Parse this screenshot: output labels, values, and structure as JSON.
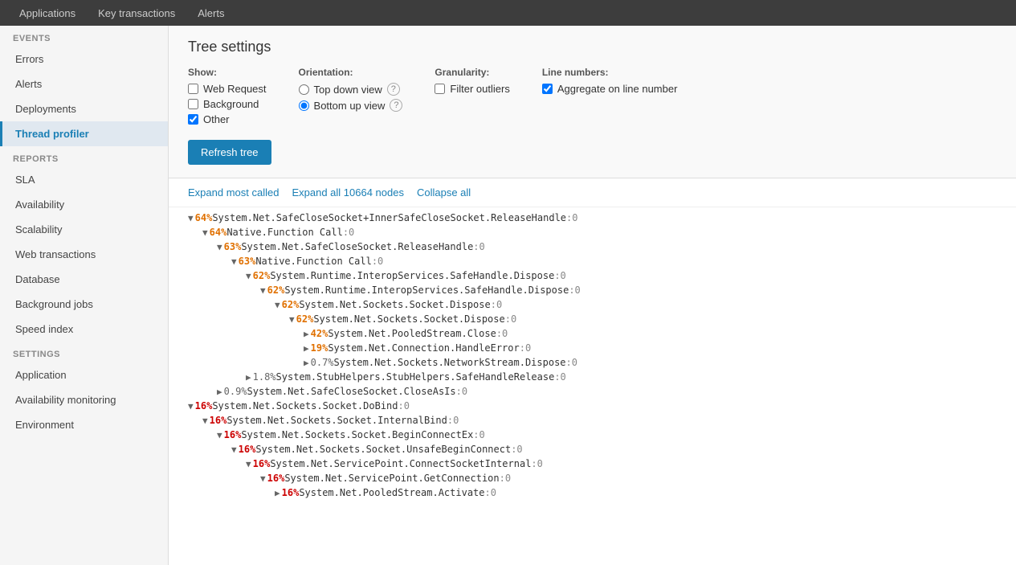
{
  "topNav": {
    "items": [
      {
        "label": "Applications",
        "active": false
      },
      {
        "label": "Key transactions",
        "active": false
      },
      {
        "label": "Alerts",
        "active": false
      }
    ]
  },
  "sidebar": {
    "events_label": "EVENTS",
    "reports_label": "REPORTS",
    "settings_label": "SETTINGS",
    "events_items": [
      {
        "label": "Errors",
        "active": false
      },
      {
        "label": "Alerts",
        "active": false
      },
      {
        "label": "Deployments",
        "active": false
      },
      {
        "label": "Thread profiler",
        "active": true
      }
    ],
    "reports_items": [
      {
        "label": "SLA",
        "active": false
      },
      {
        "label": "Availability",
        "active": false
      },
      {
        "label": "Scalability",
        "active": false
      },
      {
        "label": "Web transactions",
        "active": false
      },
      {
        "label": "Database",
        "active": false
      },
      {
        "label": "Background jobs",
        "active": false
      },
      {
        "label": "Speed index",
        "active": false
      }
    ],
    "settings_items": [
      {
        "label": "Application",
        "active": false
      },
      {
        "label": "Availability monitoring",
        "active": false
      },
      {
        "label": "Environment",
        "active": false
      }
    ]
  },
  "treeSettings": {
    "title": "Tree settings",
    "show_label": "Show:",
    "show_options": [
      {
        "label": "Web Request",
        "checked": false
      },
      {
        "label": "Background",
        "checked": false
      },
      {
        "label": "Other",
        "checked": true
      }
    ],
    "orientation_label": "Orientation:",
    "orientation_options": [
      {
        "label": "Top down view",
        "checked": false,
        "has_help": true
      },
      {
        "label": "Bottom up view",
        "checked": true,
        "has_help": true
      }
    ],
    "granularity_label": "Granularity:",
    "granularity_options": [
      {
        "label": "Filter outliers",
        "checked": false
      }
    ],
    "line_numbers_label": "Line numbers:",
    "line_numbers_options": [
      {
        "label": "Aggregate on line number",
        "checked": true
      }
    ],
    "refresh_button": "Refresh tree"
  },
  "treeToolbar": {
    "expand_most": "Expand most called",
    "expand_all": "Expand all 10664 nodes",
    "collapse_all": "Collapse all"
  },
  "treeNodes": [
    {
      "indent": 0,
      "toggle": "▼",
      "pct": "64%",
      "pct_class": "pct-orange",
      "text": "System.Net.SafeCloseSocket+InnerSafeCloseSocket.ReleaseHandle",
      "num": ":0"
    },
    {
      "indent": 1,
      "toggle": "▼",
      "pct": "64%",
      "pct_class": "pct-orange",
      "text": "Native.Function Call",
      "num": ":0"
    },
    {
      "indent": 2,
      "toggle": "▼",
      "pct": "63%",
      "pct_class": "pct-orange",
      "text": "System.Net.SafeCloseSocket.ReleaseHandle",
      "num": ":0"
    },
    {
      "indent": 3,
      "toggle": "▼",
      "pct": "63%",
      "pct_class": "pct-orange",
      "text": "Native.Function Call",
      "num": ":0"
    },
    {
      "indent": 4,
      "toggle": "▼",
      "pct": "62%",
      "pct_class": "pct-orange",
      "text": "System.Runtime.InteropServices.SafeHandle.Dispose",
      "num": ":0"
    },
    {
      "indent": 5,
      "toggle": "▼",
      "pct": "62%",
      "pct_class": "pct-orange",
      "text": "System.Runtime.InteropServices.SafeHandle.Dispose",
      "num": ":0"
    },
    {
      "indent": 6,
      "toggle": "▼",
      "pct": "62%",
      "pct_class": "pct-orange",
      "text": "System.Net.Sockets.Socket.Dispose",
      "num": ":0"
    },
    {
      "indent": 7,
      "toggle": "▼",
      "pct": "62%",
      "pct_class": "pct-orange",
      "text": "System.Net.Sockets.Socket.Dispose",
      "num": ":0"
    },
    {
      "indent": 8,
      "toggle": "▶",
      "pct": "42%",
      "pct_class": "pct-orange",
      "text": "System.Net.PooledStream.Close",
      "num": ":0"
    },
    {
      "indent": 8,
      "toggle": "▶",
      "pct": "19%",
      "pct_class": "pct-orange",
      "text": "System.Net.Connection.HandleError",
      "num": ":0"
    },
    {
      "indent": 8,
      "toggle": "▶",
      "pct": "0.7%",
      "pct_class": "pct-gray",
      "text": "System.Net.Sockets.NetworkStream.Dispose",
      "num": ":0"
    },
    {
      "indent": 4,
      "toggle": "▶",
      "pct": "1.8%",
      "pct_class": "pct-gray",
      "text": "System.StubHelpers.StubHelpers.SafeHandleRelease",
      "num": ":0"
    },
    {
      "indent": 2,
      "toggle": "▶",
      "pct": "0.9%",
      "pct_class": "pct-gray",
      "text": "System.Net.SafeCloseSocket.CloseAsIs",
      "num": ":0"
    },
    {
      "indent": 0,
      "toggle": "▼",
      "pct": "16%",
      "pct_class": "pct-red",
      "text": "System.Net.Sockets.Socket.DoBind",
      "num": ":0"
    },
    {
      "indent": 1,
      "toggle": "▼",
      "pct": "16%",
      "pct_class": "pct-red",
      "text": "System.Net.Sockets.Socket.InternalBind",
      "num": ":0"
    },
    {
      "indent": 2,
      "toggle": "▼",
      "pct": "16%",
      "pct_class": "pct-red",
      "text": "System.Net.Sockets.Socket.BeginConnectEx",
      "num": ":0"
    },
    {
      "indent": 3,
      "toggle": "▼",
      "pct": "16%",
      "pct_class": "pct-red",
      "text": "System.Net.Sockets.Socket.UnsafeBeginConnect",
      "num": ":0"
    },
    {
      "indent": 4,
      "toggle": "▼",
      "pct": "16%",
      "pct_class": "pct-red",
      "text": "System.Net.ServicePoint.ConnectSocketInternal",
      "num": ":0"
    },
    {
      "indent": 5,
      "toggle": "▼",
      "pct": "16%",
      "pct_class": "pct-red",
      "text": "System.Net.ServicePoint.GetConnection",
      "num": ":0"
    },
    {
      "indent": 6,
      "toggle": "▶",
      "pct": "16%",
      "pct_class": "pct-red",
      "text": "System.Net.PooledStream.Activate",
      "num": ":0"
    }
  ]
}
